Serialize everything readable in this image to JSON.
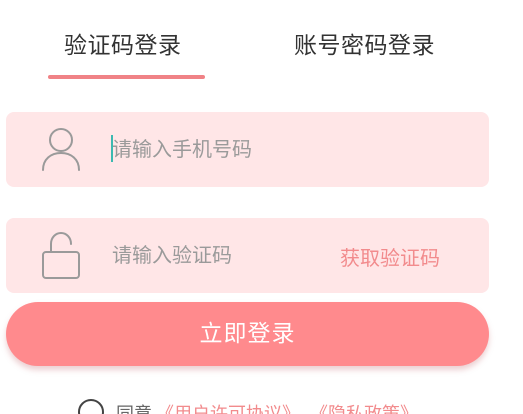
{
  "tabs": {
    "sms_login": "验证码登录",
    "password_login": "账号密码登录"
  },
  "phone": {
    "placeholder": "请输入手机号码",
    "icon": "user-icon"
  },
  "code": {
    "placeholder": "请输入验证码",
    "get_code_label": "获取验证码",
    "icon": "lock-icon"
  },
  "login_button": "立即登录",
  "agreement": {
    "prefix": "同意",
    "user_agreement": "《用户许可协议》",
    "privacy_policy": "《隐私政策》"
  },
  "colors": {
    "accent": "#ff8a8d",
    "field_bg": "#ffe6e7",
    "link": "#f28b8d"
  }
}
